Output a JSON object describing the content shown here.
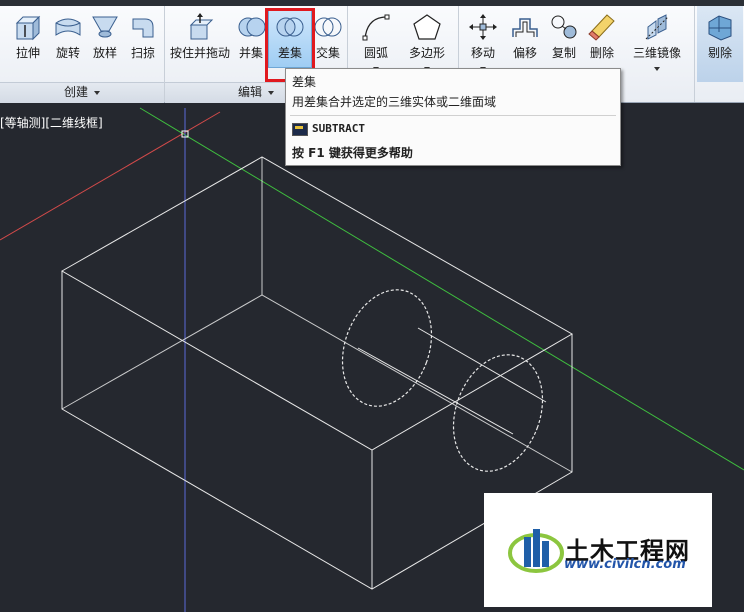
{
  "ribbon": {
    "create_tools": [
      {
        "name": "extrude",
        "label": "拉伸"
      },
      {
        "name": "revolve",
        "label": "旋转"
      },
      {
        "name": "loft",
        "label": "放样"
      },
      {
        "name": "sweep",
        "label": "扫掠"
      }
    ],
    "presspull_label": "按住并拖动",
    "union_label": "并集",
    "subtract_label": "差集",
    "intersect_label": "交集",
    "arc_label": "圆弧",
    "polygon_label": "多边形",
    "move_label": "移动",
    "offset_label": "偏移",
    "copy_label": "复制",
    "erase_label": "删除",
    "mirror3d_label": "三维镜像",
    "cull_label": "剔除",
    "panel_create": "创建",
    "panel_edit": "编辑"
  },
  "tooltip": {
    "title": "差集",
    "description": "用差集合并选定的三维实体或二维面域",
    "command": "SUBTRACT",
    "help": "按 F1 键获得更多帮助"
  },
  "viewport": {
    "label": "[等轴测][二维线框]"
  },
  "watermark": {
    "name": "土木工程网",
    "url": "www.civilcn.com"
  },
  "colors": {
    "background": "#25282f",
    "highlight": "#e0191f",
    "axis_x": "#d24a4a",
    "axis_y": "#3fbf3f",
    "axis_z": "#5a6ad8"
  },
  "icons": {
    "cmd": "subtract-command-icon"
  }
}
